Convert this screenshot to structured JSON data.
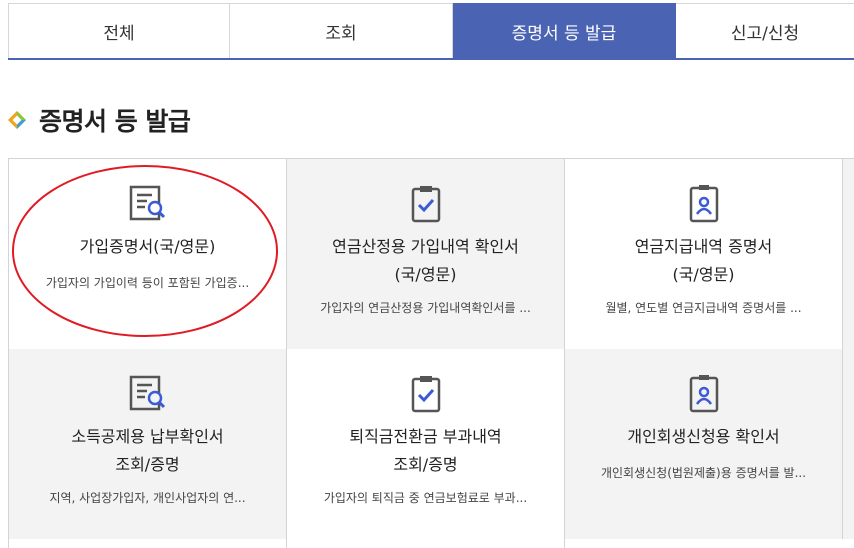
{
  "tabs": [
    {
      "label": "전체"
    },
    {
      "label": "조회"
    },
    {
      "label": "증명서 등 발급"
    },
    {
      "label": "신고/신청"
    }
  ],
  "section": {
    "title": "증명서 등 발급"
  },
  "cards": [
    {
      "title_line1": "가입증명서(국/영문)",
      "title_line2": "",
      "desc": "가입자의 가입이력 등이 포함된 가입증...",
      "icon": "document-search-icon"
    },
    {
      "title_line1": "연금산정용 가입내역 확인서",
      "title_line2": "(국/영문)",
      "desc": "가입자의 연금산정용 가입내역확인서를 ...",
      "icon": "clipboard-check-icon"
    },
    {
      "title_line1": "연금지급내역 증명서",
      "title_line2": "(국/영문)",
      "desc": "월별, 연도별 연금지급내역 증명서를 ...",
      "icon": "id-badge-icon"
    },
    {
      "title_line1": "소득공제용 납부확인서",
      "title_line2": "조회/증명",
      "desc": "지역, 사업장가입자, 개인사업자의 연...",
      "icon": "document-search-icon"
    },
    {
      "title_line1": "퇴직금전환금 부과내역",
      "title_line2": "조회/증명",
      "desc": "가입자의 퇴직금 중 연금보험료로 부과...",
      "icon": "clipboard-check-icon"
    },
    {
      "title_line1": "개인회생신청용 확인서",
      "title_line2": "",
      "desc": "개인회생신청(법원제출)용 증명서를 발...",
      "icon": "id-badge-icon"
    }
  ],
  "colors": {
    "accent": "#4a63b3",
    "icon_gray": "#555555",
    "icon_blue": "#3b5bd6",
    "annotation": "#e01b24"
  }
}
